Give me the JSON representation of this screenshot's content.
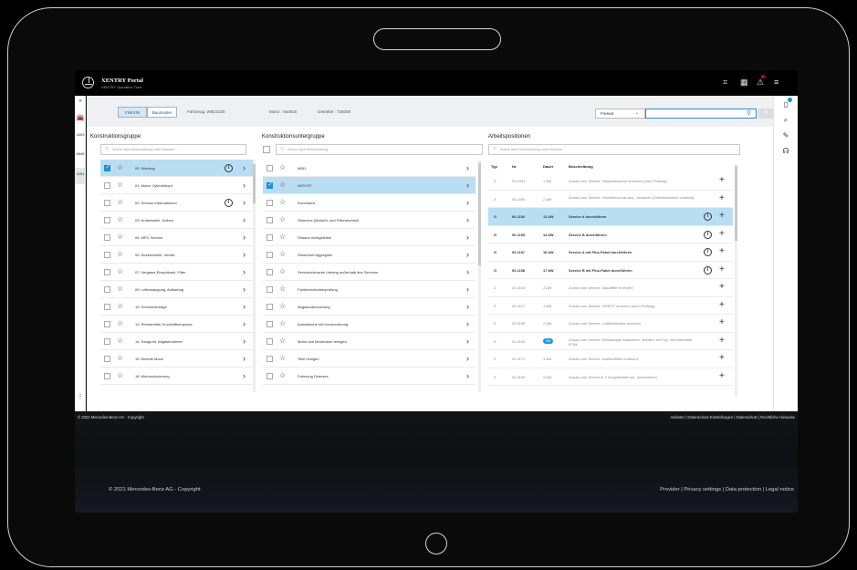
{
  "portal": {
    "title": "XENTRY Portal",
    "subtitle": "XENTRY Operation Time"
  },
  "left_rail": {
    "items": [
      "3453",
      "6848",
      "3251"
    ],
    "active": "3251"
  },
  "toolbar": {
    "fin_vin": "FIN/VIN",
    "baumuster": "Baumuster",
    "fahrzeug": "Fahrzeug: W0D2100",
    "motor": "Motor : 654920",
    "getriebe": "Getriebe : 725008",
    "freitext": "Freitext"
  },
  "col1": {
    "title": "Konstruktionsgruppe",
    "filter_placeholder": "Suche nach Beschreibung oder Nummer ...",
    "items": [
      {
        "label": "00: Wartung",
        "checked": true,
        "info": true,
        "selected": true
      },
      {
        "label": "01: Motor, Zylinderkopf",
        "checked": false,
        "info": false,
        "selected": false
      },
      {
        "label": "02: Service-Informationen",
        "checked": false,
        "info": true,
        "selected": false
      },
      {
        "label": "03: Kurbelwelle, Kolben",
        "checked": false,
        "info": false,
        "selected": false
      },
      {
        "label": "04: MPC-Service",
        "checked": false,
        "info": false,
        "selected": false
      },
      {
        "label": "05: Nockenwelle, Ventile",
        "checked": false,
        "info": false,
        "selected": false
      },
      {
        "label": "07: Vergaser,Einspritzanl.,Filter",
        "checked": false,
        "info": false,
        "selected": false
      },
      {
        "label": "09: Luftansaugung, Aufladung",
        "checked": false,
        "info": false,
        "selected": false
      },
      {
        "label": "10: Serviceverträge",
        "checked": false,
        "info": false,
        "selected": false
      },
      {
        "label": "13: Riementrieb Druckluftkompress.",
        "checked": false,
        "info": false,
        "selected": false
      },
      {
        "label": "14: Saugrohr, Abgaskrümmer",
        "checked": false,
        "info": false,
        "selected": false
      },
      {
        "label": "15: Elektrik Motor",
        "checked": false,
        "info": false,
        "selected": false
      },
      {
        "label": "18: Motorschmierung",
        "checked": false,
        "info": false,
        "selected": false
      }
    ]
  },
  "col2": {
    "title": "Konstruktionsuntergruppe",
    "filter_placeholder": "Suche nach Beschreibung",
    "items": [
      {
        "label": "MBD",
        "checked": false,
        "selected": false
      },
      {
        "label": "ASSYST",
        "checked": true,
        "selected": true
      },
      {
        "label": "Durchsicht",
        "checked": false,
        "selected": false
      },
      {
        "label": "Ölservice (Motoröl- und Filterwechsel)",
        "checked": false,
        "selected": false
      },
      {
        "label": "Ölstand richtigstellen",
        "checked": false,
        "selected": false
      },
      {
        "label": "Ölwechsel Aggregate",
        "checked": false,
        "selected": false
      },
      {
        "label": "Servicerelevante Umfang außerhalb des Services",
        "checked": false,
        "selected": false
      },
      {
        "label": "Fahrtenschreiberprüfung",
        "checked": false,
        "selected": false
      },
      {
        "label": "Abgasuntersuchung",
        "checked": false,
        "selected": false
      },
      {
        "label": "Autowäsche mit Konservierung",
        "checked": false,
        "selected": false
      },
      {
        "label": "Motor und Motorraum reinigen",
        "checked": false,
        "selected": false
      },
      {
        "label": "Teile reinigen",
        "checked": false,
        "selected": false
      },
      {
        "label": "Fahrzeug Diverses",
        "checked": false,
        "selected": false
      }
    ]
  },
  "col3": {
    "title": "Arbeitspositionen",
    "filter_placeholder": "Suche nach Beschreibung oder Nummer ...",
    "headers": {
      "typ": "Typ",
      "nr": "Nr.",
      "dauer": "Dauer",
      "beschreibung": "Beschreibung"
    },
    "rows": [
      {
        "typ": "Z",
        "nr": "00-1001",
        "dauer": "1 AW",
        "desc": "Zusatz zum Service: Verbandstasche erneuern (nach Prüfung)",
        "style": "ital",
        "info": false,
        "pill": false
      },
      {
        "typ": "Z",
        "nr": "00-1060",
        "dauer": "2 AW",
        "desc": "Zusatz zum Service: Unterfahrschutz aus-, einbauen (Unterfahrschutz verdeckt)",
        "style": "ital",
        "info": false,
        "pill": false
      },
      {
        "typ": "G",
        "nr": "00-1154",
        "dauer": "13 AW",
        "desc": "Service A durchführen",
        "style": "bold sel",
        "info": true,
        "pill": false
      },
      {
        "typ": "G",
        "nr": "00-1155",
        "dauer": "14 AW",
        "desc": "Service B durchführen",
        "style": "bold",
        "info": true,
        "pill": false
      },
      {
        "typ": "G",
        "nr": "00-1157",
        "dauer": "18 AW",
        "desc": "Service A mit Plus-Paket durchführen",
        "style": "bold",
        "info": true,
        "pill": false
      },
      {
        "typ": "G",
        "nr": "00-1158",
        "dauer": "17 AW",
        "desc": "Service B mit Plus-Paket durchführen",
        "style": "bold",
        "info": true,
        "pill": false
      },
      {
        "typ": "Z",
        "nr": "00-1164",
        "dauer": "1 AW",
        "desc": "Zusatz zum Service: Staubfilter erneuern",
        "style": "ital",
        "info": false,
        "pill": false
      },
      {
        "typ": "Z",
        "nr": "00-1167",
        "dauer": "1 AW",
        "desc": "Zusatz zum Service: TIREFIT erneuern (nach Prüfung)",
        "style": "ital",
        "info": false,
        "pill": false
      },
      {
        "typ": "Z",
        "nr": "00-1168",
        "dauer": "2 AW",
        "desc": "Zusatz zum Service: Luftfiltereinsatz erneuern",
        "style": "ital",
        "info": false,
        "pill": false
      },
      {
        "typ": "Z",
        "nr": "00-1169",
        "dauer": "2M",
        "desc": "Zusatz zum Service: Klimaanlage evakuieren, befüllen, bei Fzg. mit Kältemittel R744",
        "style": "ital",
        "info": false,
        "pill": true
      },
      {
        "typ": "Z",
        "nr": "00-1171",
        "dauer": "4 AW",
        "desc": "Zusatz zum Service: Kraftstofffilter erneuern",
        "style": "ital",
        "info": false,
        "pill": false
      },
      {
        "typ": "Z",
        "nr": "00-1184",
        "dauer": "5 AW",
        "desc": "Zusatz zum Service A: 2 Komplettäder ab-, anmontieren",
        "style": "ital",
        "info": false,
        "pill": false
      }
    ]
  },
  "footer_small": {
    "copyright": "© 2022 Mercedes-Benz AG - Copyright",
    "links": "Anbieter  |  Datenschutz-Einstellungen  |  Datenschutz  |  Rechtliche Hinweise"
  },
  "footer_big": {
    "copyright": "© 2021 Mercedes-Benz AG - Copyright",
    "links": "Provider  |  Privacy settings  |  Data protection  |  Legal notice"
  },
  "colors": {
    "accent": "#1d8fd6",
    "selected_row": "#b9def4",
    "alert": "#d0021b"
  }
}
